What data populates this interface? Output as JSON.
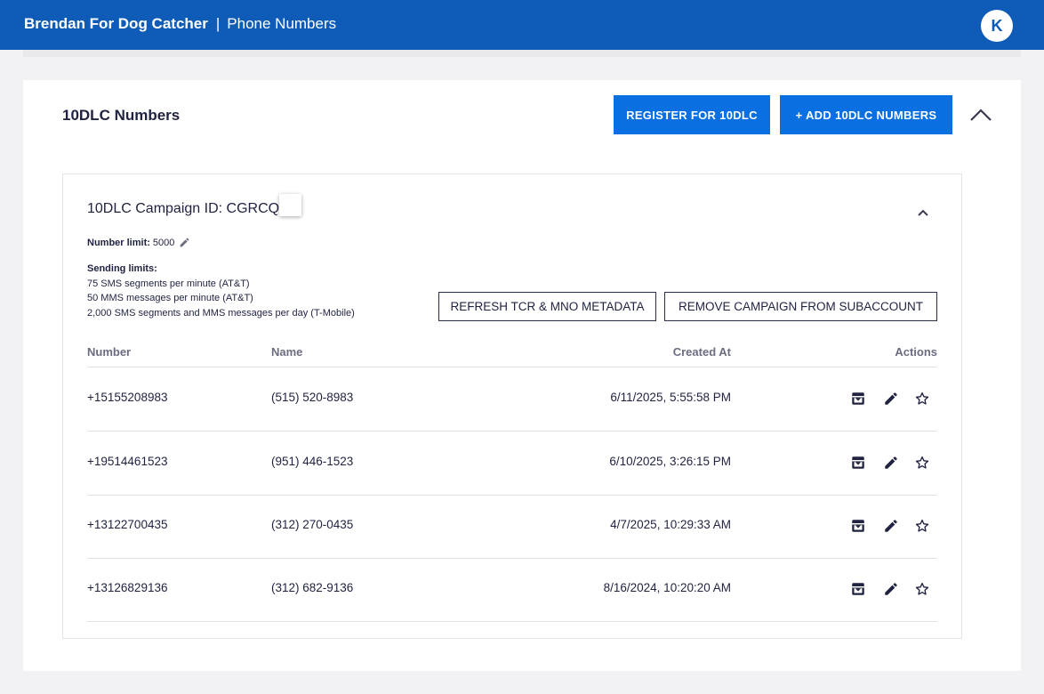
{
  "header": {
    "app_name": "Brendan For Dog Catcher",
    "separator": "|",
    "page_name": "Phone Numbers",
    "avatar_initial": "K",
    "bar_color": "#0f5cb8"
  },
  "section": {
    "title": "10DLC Numbers",
    "register_label": "REGISTER FOR 10DLC",
    "add_label": "+ ADD 10DLC NUMBERS",
    "accent_color": "#0a6fe0"
  },
  "campaign": {
    "title": "10DLC Campaign ID: CGRCQ",
    "number_limit_label": "Number limit:",
    "number_limit_value": "5000",
    "sending_limits_label": "Sending limits:",
    "sending_limits": [
      "75 SMS segments per minute (AT&T)",
      "50 MMS messages per minute (AT&T)",
      "2,000 SMS segments and MMS messages per day (T-Mobile)"
    ],
    "refresh_label": "REFRESH TCR & MNO METADATA",
    "remove_label": "REMOVE CAMPAIGN FROM SUBACCOUNT"
  },
  "table": {
    "columns": [
      "Number",
      "Name",
      "Created At",
      "Actions"
    ],
    "rows": [
      {
        "number": "+15155208983",
        "name": "(515) 520-8983",
        "created": "6/11/2025, 5:55:58 PM"
      },
      {
        "number": "+19514461523",
        "name": "(951) 446-1523",
        "created": "6/10/2025, 3:26:15 PM"
      },
      {
        "number": "+13122700435",
        "name": "(312) 270-0435",
        "created": "4/7/2025, 10:29:33 AM"
      },
      {
        "number": "+13126829136",
        "name": "(312) 682-9136",
        "created": "8/16/2024, 10:20:20 AM"
      }
    ],
    "action_icons": [
      "archive-icon",
      "edit-icon",
      "star-icon"
    ]
  }
}
